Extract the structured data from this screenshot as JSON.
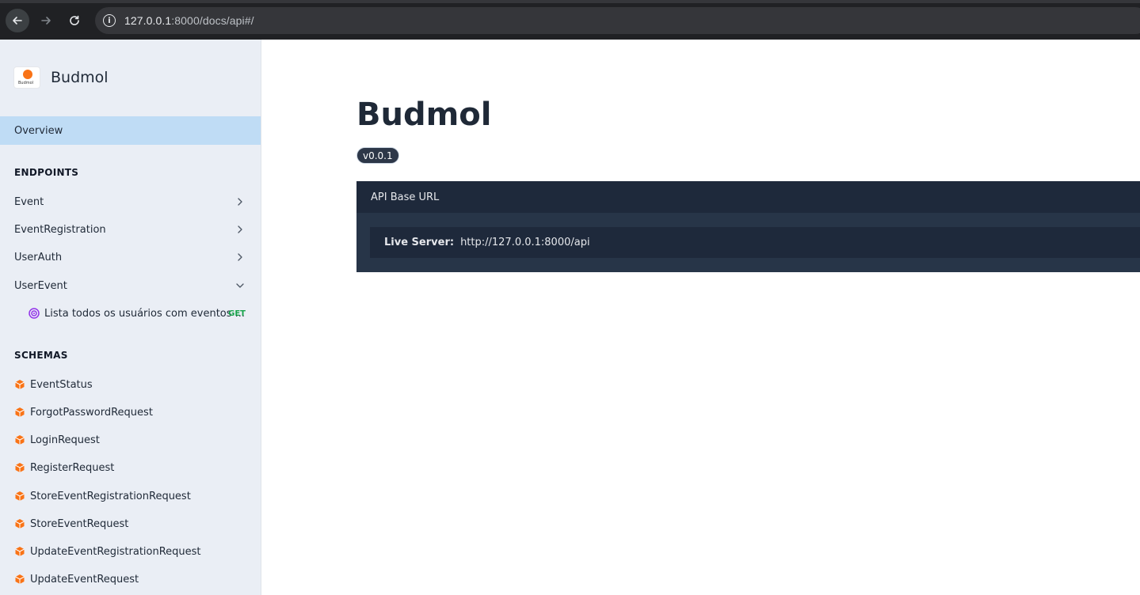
{
  "browser": {
    "url_host": "127.0.0.1",
    "url_path": ":8000/docs/api#/"
  },
  "sidebar": {
    "brand_name": "Budmol",
    "logo_text": "Budmol",
    "overview_label": "Overview",
    "endpoints_title": "ENDPOINTS",
    "endpoints": [
      {
        "label": "Event",
        "expanded": false
      },
      {
        "label": "EventRegistration",
        "expanded": false
      },
      {
        "label": "UserAuth",
        "expanded": false
      },
      {
        "label": "UserEvent",
        "expanded": true
      }
    ],
    "userevent_children": [
      {
        "label": "Lista todos os usuários com eventos ...",
        "method": "GET"
      }
    ],
    "schemas_title": "SCHEMAS",
    "schemas": [
      "EventStatus",
      "ForgotPasswordRequest",
      "LoginRequest",
      "RegisterRequest",
      "StoreEventRegistrationRequest",
      "StoreEventRequest",
      "UpdateEventRegistrationRequest",
      "UpdateEventRequest"
    ]
  },
  "main": {
    "title": "Budmol",
    "version": "v0.0.1",
    "api_base_title": "API Base URL",
    "server_label": "Live Server:",
    "server_url": "http://127.0.0.1:8000/api"
  },
  "colors": {
    "accent_orange": "#f97316",
    "method_get": "#16a34a",
    "endpoint_icon_purple": "#9333ea",
    "overview_highlight": "#bfdcf5",
    "api_box_dark": "#1e293b"
  }
}
